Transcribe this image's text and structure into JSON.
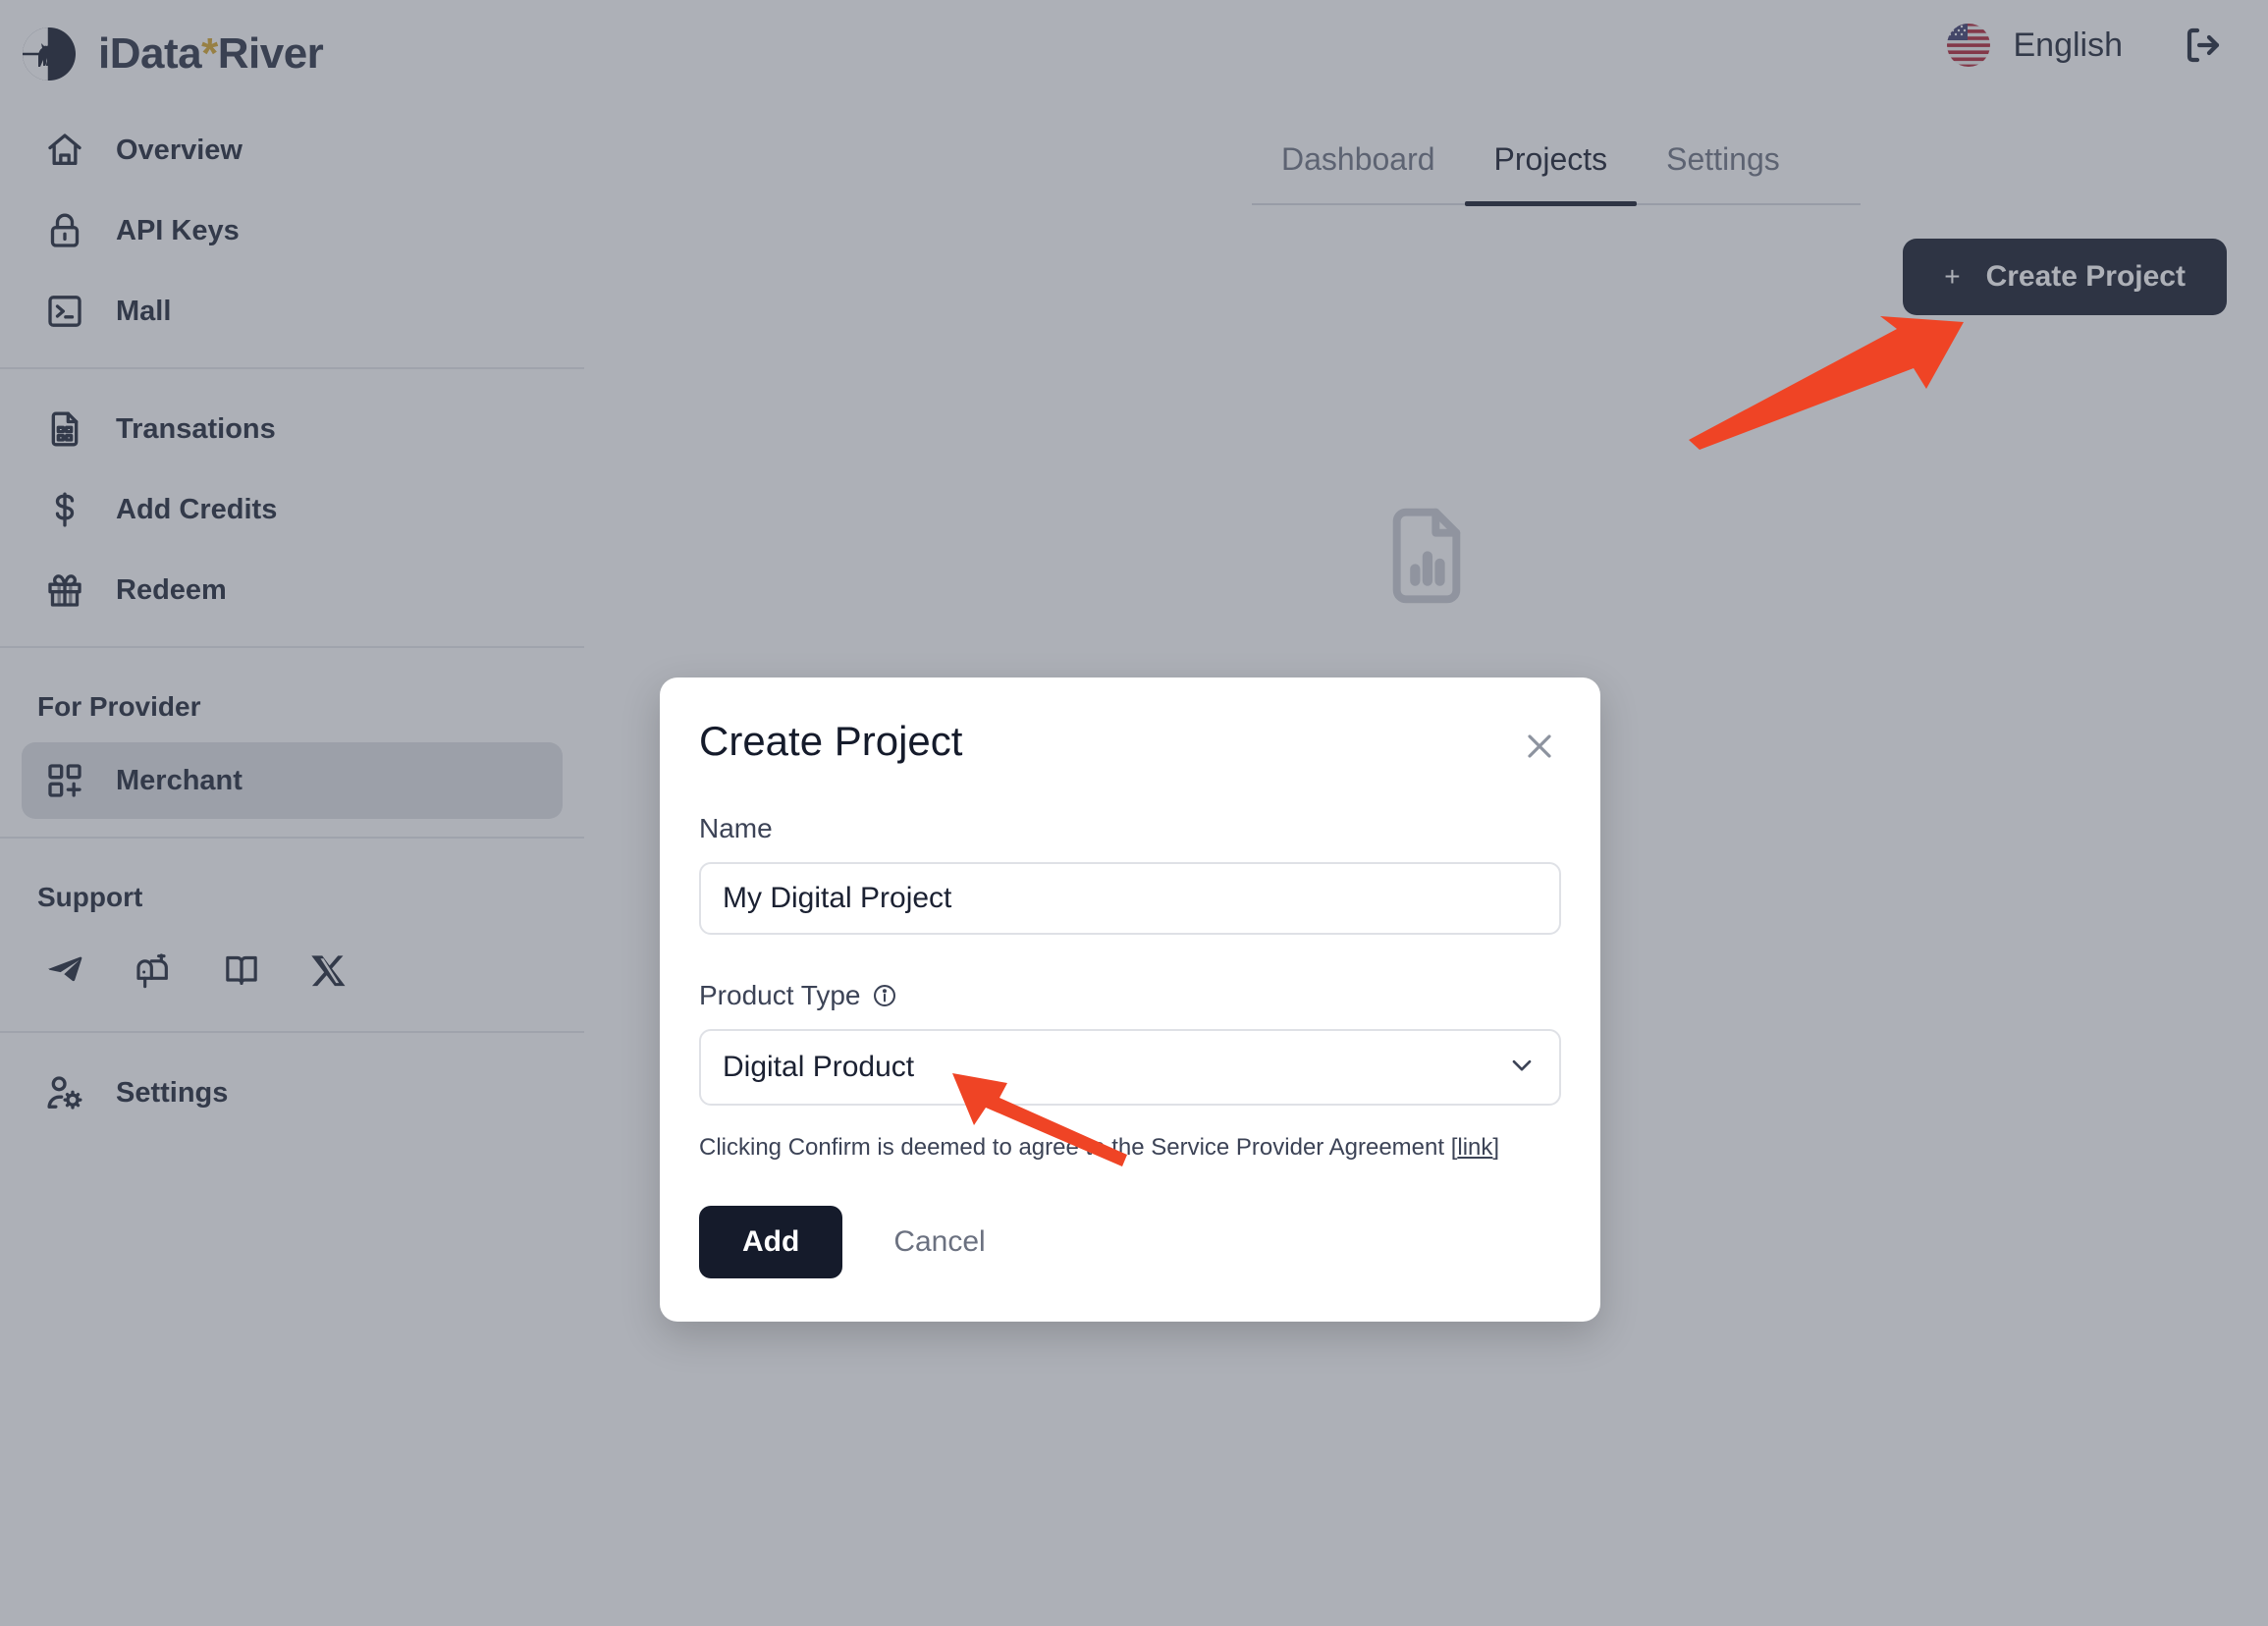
{
  "brand": {
    "name_part1": "iData",
    "star": "*",
    "name_part2": "River",
    "logo_icon": "cat-circle-logo"
  },
  "topbar": {
    "language_label": "English",
    "flag_icon": "us-flag-icon",
    "logout_icon": "logout-icon"
  },
  "sidebar": {
    "primary": [
      {
        "label": "Overview",
        "icon": "home-icon"
      },
      {
        "label": "API Keys",
        "icon": "lock-icon"
      },
      {
        "label": "Mall",
        "icon": "terminal-icon"
      }
    ],
    "billing": [
      {
        "label": "Transations",
        "icon": "document-list-icon"
      },
      {
        "label": "Add Credits",
        "icon": "dollar-icon"
      },
      {
        "label": "Redeem",
        "icon": "gift-icon"
      }
    ],
    "provider_title": "For Provider",
    "provider": [
      {
        "label": "Merchant",
        "icon": "grid-plus-icon",
        "active": true
      }
    ],
    "support_title": "Support",
    "support_icons": [
      "telegram-icon",
      "mailbox-icon",
      "book-icon",
      "x-twitter-icon"
    ],
    "footer": [
      {
        "label": "Settings",
        "icon": "user-gear-icon"
      }
    ]
  },
  "main": {
    "tabs": [
      {
        "label": "Dashboard",
        "active": false
      },
      {
        "label": "Projects",
        "active": true
      },
      {
        "label": "Settings",
        "active": false
      }
    ],
    "create_button": {
      "plus": "+",
      "label": "Create Project"
    },
    "empty_state_icon": "document-chart-icon"
  },
  "modal": {
    "title": "Create Project",
    "close_icon": "close-icon",
    "name_label": "Name",
    "name_value": "My Digital Project",
    "name_placeholder": "Name",
    "product_type_label": "Product Type",
    "product_type_info_icon": "info-icon",
    "product_type_value": "Digital Product",
    "product_type_caret_icon": "chevron-down-icon",
    "agreement_prefix": "Clicking Confirm is deemed to agree to the Service Provider Agreement [",
    "agreement_link": "link",
    "agreement_suffix": "]",
    "add_label": "Add",
    "cancel_label": "Cancel"
  },
  "annotations": {
    "arrow_color": "#ef4425",
    "arrow_create_target": "Create Project button",
    "arrow_type_target": "Digital Product select"
  },
  "colors": {
    "brand_dark": "#151b2b",
    "brand_star": "#d6a62b",
    "overlay": "#8a8d96",
    "accent_red": "#ef4425",
    "sidebar_active": "#dfe1e6"
  }
}
